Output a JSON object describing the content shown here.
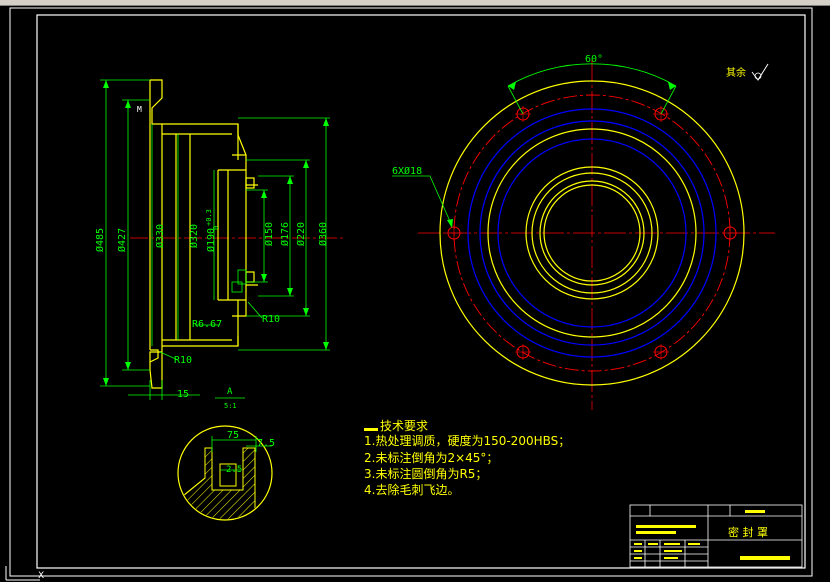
{
  "window": {
    "title_strip": ""
  },
  "dims_side": {
    "d485": "Ø485",
    "d427": "Ø427",
    "d330": "Ø330",
    "d320": "Ø320",
    "d190": "Ø190",
    "d190_tol": "+0.3",
    "d190_tol2": "0",
    "d150": "Ø150",
    "d176": "Ø176",
    "d220": "Ø220",
    "d360": "Ø360",
    "r10a": "R10",
    "r10b": "R10",
    "r6": "R6.67",
    "w15": "15",
    "sec_top": "A",
    "sec_bot": "5:1",
    "m_mark": "M"
  },
  "dims_front": {
    "angle": "60°",
    "holes": "6XØ18",
    "rough": "其余"
  },
  "detail": {
    "d75": "75",
    "d75_b": "7.5",
    "d25": "2.5"
  },
  "tech_req": {
    "title": "技术要求",
    "items": [
      "1.热处理调质，硬度为150-200HBS；",
      "2.未标注倒角为2×45°；",
      "3.未标注圆倒角为R5；",
      "4.去除毛刺飞边。"
    ]
  },
  "title_block": {
    "part_name": "密 封 罩"
  },
  "colors": {
    "background": "#000000",
    "frame": "#ffffff",
    "outline": "#ffff00",
    "dimension": "#00ff00",
    "center": "#ff0000",
    "hidden": "#0000ff",
    "text": "#ffff00"
  }
}
